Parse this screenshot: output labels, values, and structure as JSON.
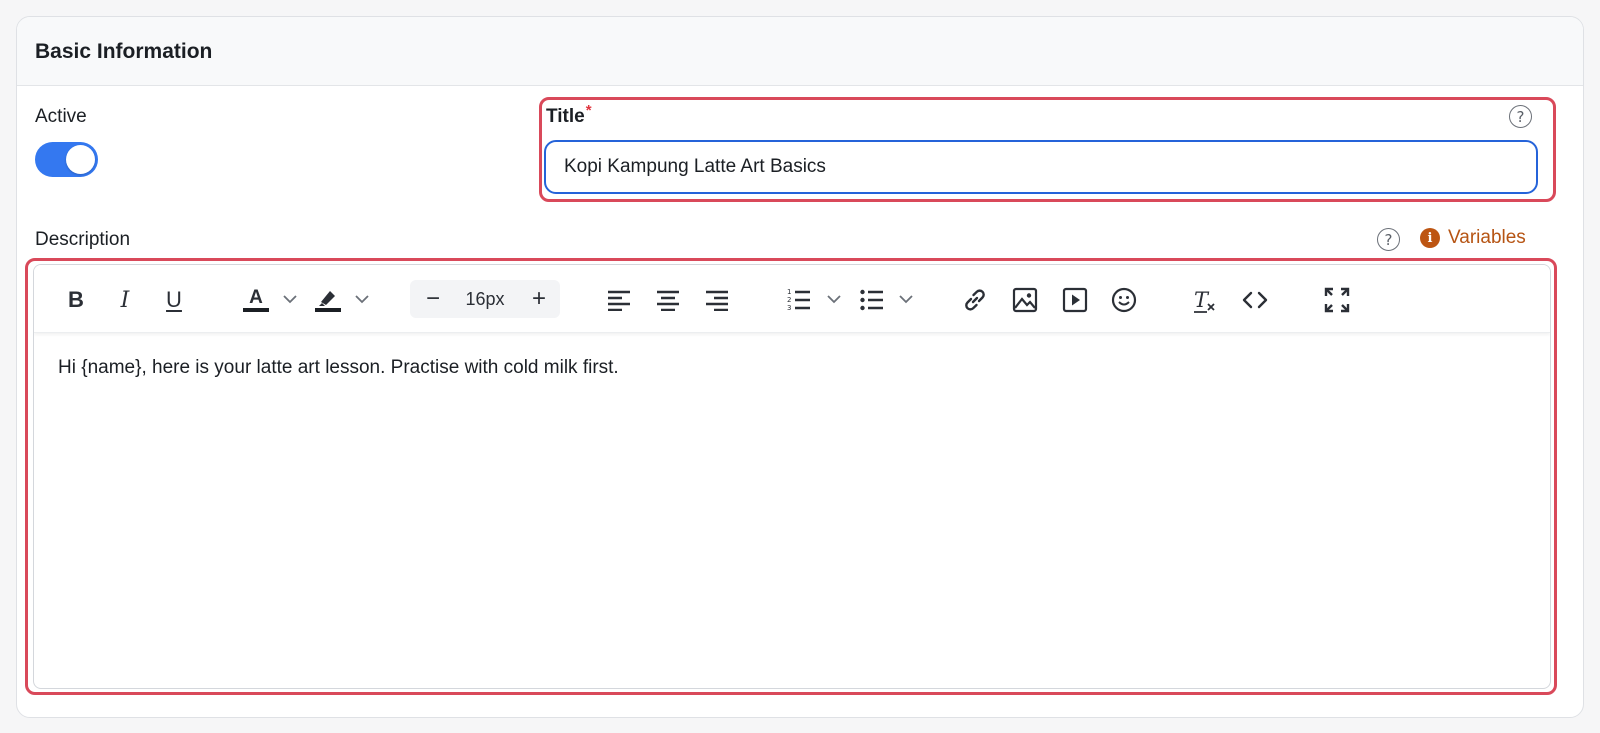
{
  "section": {
    "title": "Basic Information"
  },
  "active": {
    "label": "Active",
    "enabled": true
  },
  "title_field": {
    "label": "Title",
    "required_mark": "*",
    "value": "Kopi Kampung Latte Art Basics",
    "help_glyph": "?"
  },
  "description": {
    "label": "Description",
    "help_glyph": "?",
    "variables_label": "Variables",
    "variables_icon_glyph": "i",
    "content": "Hi {name}, here is your latte art lesson. Practise with cold milk first.",
    "toolbar": {
      "bold": "B",
      "italic": "I",
      "underline": "U",
      "font_size": "16px",
      "minus": "−",
      "plus": "+"
    }
  },
  "colors": {
    "accent": "#3478f0",
    "focus": "#2563d9",
    "highlight_outline": "#d9495a",
    "variables": "#b65413"
  }
}
